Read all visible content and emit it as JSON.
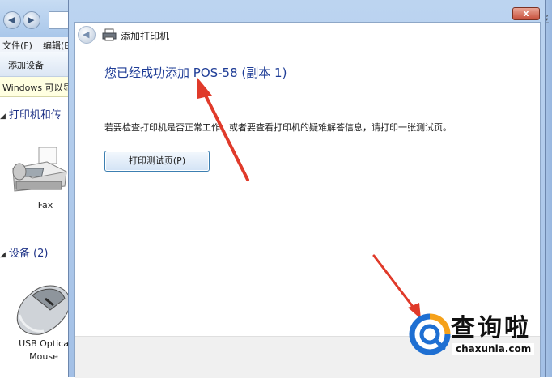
{
  "explorer": {
    "menu_file": "文件(F)",
    "menu_edit": "编辑(E",
    "toolbar_add_device": "添加设备",
    "info_bar": "Windows 可以显",
    "group_printers": "打印机和传",
    "device_fax": "Fax",
    "group_devices": "设备 (2)",
    "device_mouse_line1": "USB Optica",
    "device_mouse_line2": "Mouse",
    "right_edge_text": "泛"
  },
  "dialog": {
    "title": "添加打印机",
    "close_label": "x",
    "heading": "您已经成功添加 POS-58 (副本 1)",
    "description": "若要检查打印机是否正常工作，或者要查看打印机的疑难解答信息，请打印一张测试页。",
    "test_page_button": "打印测试页(P)"
  },
  "watermark": {
    "brand": "查询啦",
    "domain": "chaxunla.com"
  },
  "colors": {
    "heading": "#1e3c96",
    "arrow": "#e03a2a",
    "logo_blue": "#1e6fd2",
    "logo_orange": "#f5a11a"
  },
  "icons": [
    "back-arrow-icon",
    "printer-icon",
    "fax-icon",
    "mouse-icon",
    "close-icon"
  ]
}
